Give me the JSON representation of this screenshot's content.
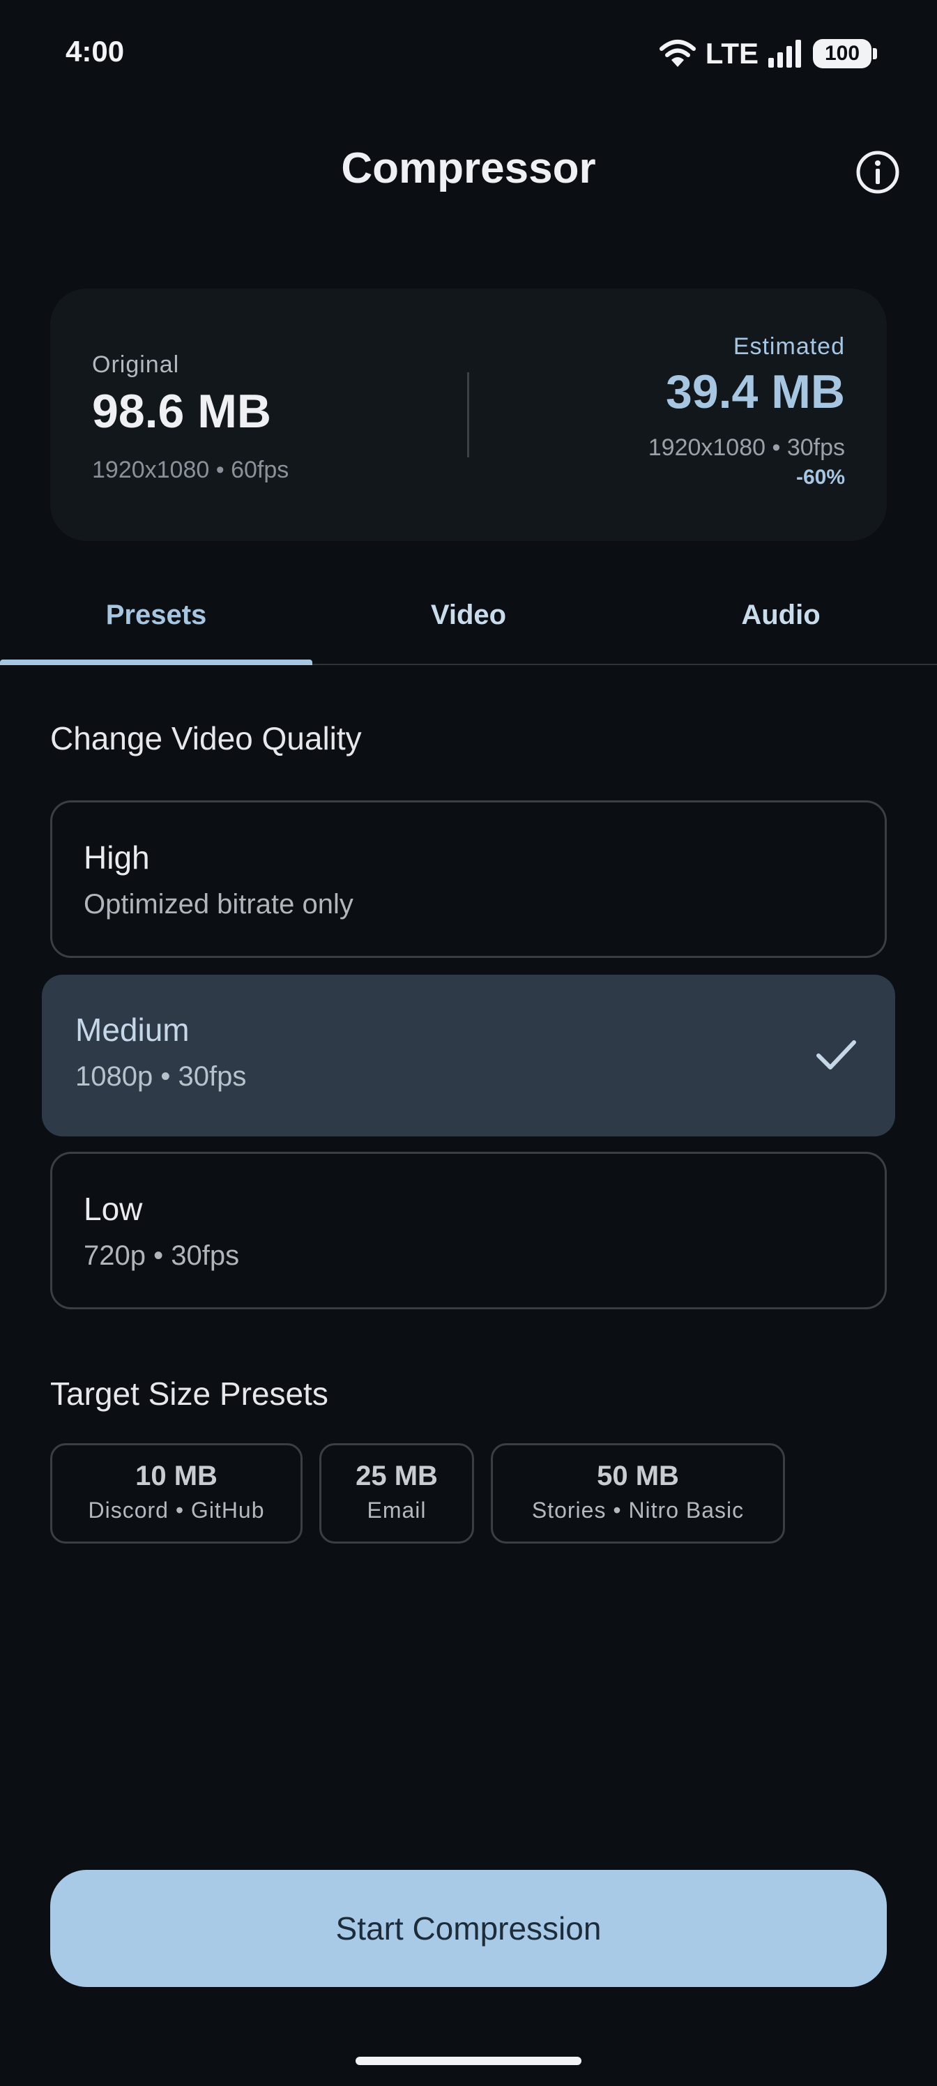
{
  "status_bar": {
    "time": "4:00",
    "network": "LTE",
    "battery": "100",
    "icons": [
      "wifi-icon",
      "signal-icon",
      "battery-icon"
    ]
  },
  "app_bar": {
    "title": "Compressor",
    "info_icon": "info-icon"
  },
  "summary": {
    "original": {
      "label": "Original",
      "size": "98.6 MB",
      "meta": "1920x1080 • 60fps"
    },
    "estimated": {
      "label": "Estimated",
      "size": "39.4 MB",
      "meta": "1920x1080 • 30fps",
      "reduction": "-60%"
    }
  },
  "tabs": [
    {
      "label": "Presets",
      "active": true
    },
    {
      "label": "Video",
      "active": false
    },
    {
      "label": "Audio",
      "active": false
    }
  ],
  "quality": {
    "title": "Change Video Quality",
    "options": [
      {
        "name": "High",
        "description": "Optimized bitrate only",
        "selected": false
      },
      {
        "name": "Medium",
        "description": "1080p • 30fps",
        "selected": true
      },
      {
        "name": "Low",
        "description": "720p • 30fps",
        "selected": false
      }
    ]
  },
  "target_size": {
    "title": "Target Size Presets",
    "presets": [
      {
        "size": "10 MB",
        "label": "Discord • GitHub"
      },
      {
        "size": "25 MB",
        "label": "Email"
      },
      {
        "size": "50 MB",
        "label": "Stories • Nitro Basic"
      }
    ]
  },
  "action": {
    "start_label": "Start Compression"
  },
  "colors": {
    "background": "#0b0e12",
    "card": "#12171c",
    "accent": "#a7c6e1",
    "selected_card": "#2e3a47",
    "button": "#a9cae6",
    "button_text": "#1c2c3a"
  }
}
